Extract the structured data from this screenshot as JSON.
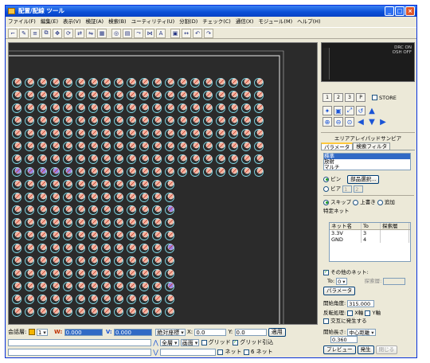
{
  "window": {
    "title": "配置/配線 ツール",
    "controls": [
      "_",
      "□",
      "×"
    ]
  },
  "menu": [
    "ファイル(F)",
    "編集(E)",
    "表示(V)",
    "検証(A)",
    "検索(B)",
    "ユーティリティ(U)",
    "分割(D)",
    "チェック(C)",
    "通信(X)",
    "モジュール(M)",
    "ヘルプ(H)"
  ],
  "toolbar": {
    "icons": [
      "line-icon",
      "pen-icon",
      "align-icon",
      "copy-icon",
      "move-icon",
      "rotate-icon",
      "flip-icon",
      "mirror-icon",
      "group-icon",
      "via-icon",
      "bus-icon",
      "route-icon",
      "net-icon",
      "text-icon",
      "pad-icon",
      "measure-icon",
      "undo-icon",
      "redo-icon"
    ]
  },
  "minimap": {
    "lines": [
      "DRC ON",
      "OSH OFF"
    ]
  },
  "layers": {
    "buttons": [
      "1",
      "2",
      "3",
      "P"
    ],
    "store_label": "STORE"
  },
  "panel": {
    "heading": "エリアアレイパッドサンピア",
    "tabs": [
      "パラメータ",
      "検索フィルタ"
    ],
    "list_items": [
      "標準",
      "放射",
      "マルチ"
    ],
    "selected_list_item": "標準",
    "pin_label": "ピン",
    "pin_button": "部品選択...",
    "via_label": "ビア",
    "via_field": "1",
    "via_field2": "2",
    "mode_options": [
      "スキップ",
      "上書き",
      "追加"
    ],
    "mode_selected": "スキップ",
    "specific_net_label": "特定ネット",
    "table": {
      "columns": [
        "ネット名",
        "To",
        "探索層"
      ],
      "rows": [
        {
          "net": "3.3V",
          "to": "3",
          "layer": ""
        },
        {
          "net": "GND",
          "to": "4",
          "layer": ""
        }
      ]
    },
    "other_nets_label": "その他のネット:",
    "other_nets_checked": true,
    "to_label": "To:",
    "to_value": "0",
    "layer_label": "探索層:",
    "param_button": "パラメータ",
    "start_angle_label": "開始角度:",
    "start_angle_value": "315.000",
    "reverse_label": "反転処理:",
    "x_axis_label": "X軸",
    "y_axis_label": "Y軸",
    "alternate_label": "交互に発生する",
    "fanout_length_label": "開始長さ:",
    "fanout_length_mode": "中心距離",
    "fanout_length_value": "0.360",
    "preview_button": "プレビュー",
    "generate_button": "発生",
    "close_button": "閉じる"
  },
  "status": {
    "layer_label": "会話層:",
    "layer_value": "1",
    "w_label": "W:",
    "w_value": "0.000",
    "v_label": "V:",
    "v_value": "0.000",
    "snap_label": "絶対座標",
    "x_label": "X:",
    "x_value": "0.0",
    "y_label": "Y:",
    "y_value": "0.0",
    "apply_button": "適用",
    "mode1": "全層",
    "mode2": "画面",
    "grid_label": "グリッド",
    "grid_snap_label": "グリッド引込",
    "net_label": "ネット",
    "net_label2": "ネット",
    "rec_prefix": "6"
  },
  "colors": {
    "pad_outer": "#7fd9e8",
    "pad_inner": "#f4b4a0",
    "pad_purple": "#9a7fe6",
    "canvas_bg": "#2b2b2b",
    "accent": "#316ac5"
  }
}
